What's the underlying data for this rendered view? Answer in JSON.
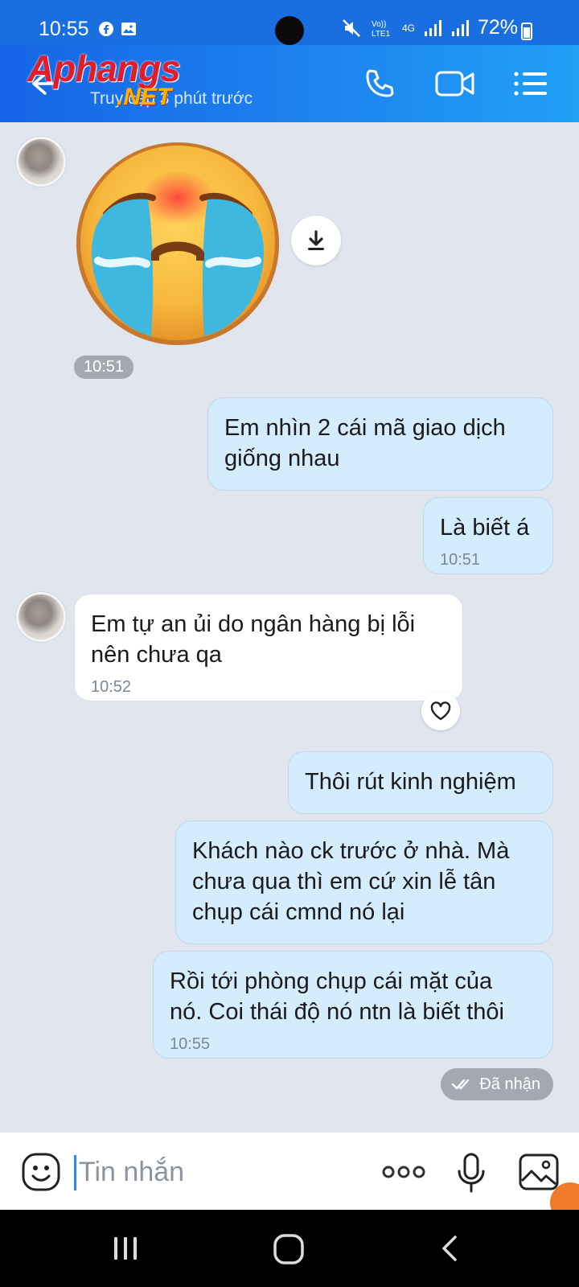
{
  "status_bar": {
    "time": "10:55",
    "network": "4G",
    "battery": "72%"
  },
  "header": {
    "watermark": "Aphangs",
    "watermark_suffix": ".NET",
    "subtitle": "Truy cập 3 phút trước"
  },
  "messages": [
    {
      "id": "m1",
      "side": "them",
      "type": "sticker",
      "time": "10:51"
    },
    {
      "id": "m2",
      "side": "me",
      "text_lines": [
        "Em nhìn 2 cái mã giao dịch",
        "giống nhau"
      ]
    },
    {
      "id": "m3",
      "side": "me",
      "text": "Là biết á",
      "time": "10:51"
    },
    {
      "id": "m4",
      "side": "them",
      "text_lines": [
        "Em tự an ủi do ngân hàng bị lỗi",
        "nên chưa qa"
      ],
      "time": "10:52"
    },
    {
      "id": "m5",
      "side": "me",
      "text": "Thôi rút kinh nghiệm"
    },
    {
      "id": "m6",
      "side": "me",
      "text_lines": [
        "Khách nào ck trước ở nhà. Mà",
        "chưa qua thì em cứ xin lễ tân",
        "chụp cái cmnd nó lại"
      ]
    },
    {
      "id": "m7",
      "side": "me",
      "text_lines": [
        "Rồi tới phòng chụp cái mặt của",
        "nó. Coi thái độ nó ntn là biết thôi"
      ],
      "time": "10:55"
    }
  ],
  "receipt": "Đã nhận",
  "input": {
    "placeholder": "Tin nhắn"
  },
  "icons": {
    "back": "back-arrow-icon",
    "call": "phone-icon",
    "video": "video-camera-icon",
    "menu": "menu-list-icon",
    "download": "download-icon",
    "react": "heart-icon",
    "emoji": "emoji-icon",
    "more": "more-dots-icon",
    "mic": "microphone-icon",
    "image": "image-icon"
  },
  "colors": {
    "header": "#1d86f0",
    "outgoing_bubble": "#d5ecfd",
    "incoming_bubble": "#ffffff",
    "chat_bg": "#e1e6ee",
    "accent": "#2a8cf3"
  }
}
